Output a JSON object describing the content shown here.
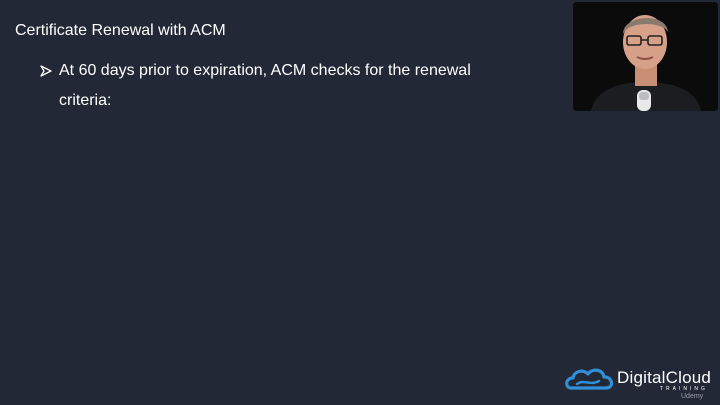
{
  "slide": {
    "title": "Certificate Renewal with ACM",
    "bullets": [
      {
        "line1": "At 60 days prior to expiration, ACM checks for the renewal",
        "line2": "criteria:"
      }
    ]
  },
  "brand": {
    "name": "DigitalCloud",
    "tagline": "TRAINING",
    "platform": "Udemy"
  },
  "colors": {
    "background": "#232836",
    "text": "#ffffff",
    "logo_blue": "#2f8fd8"
  },
  "icons": {
    "bullet": "arrowhead-bullet-icon",
    "logo": "cloud-logo-icon"
  }
}
